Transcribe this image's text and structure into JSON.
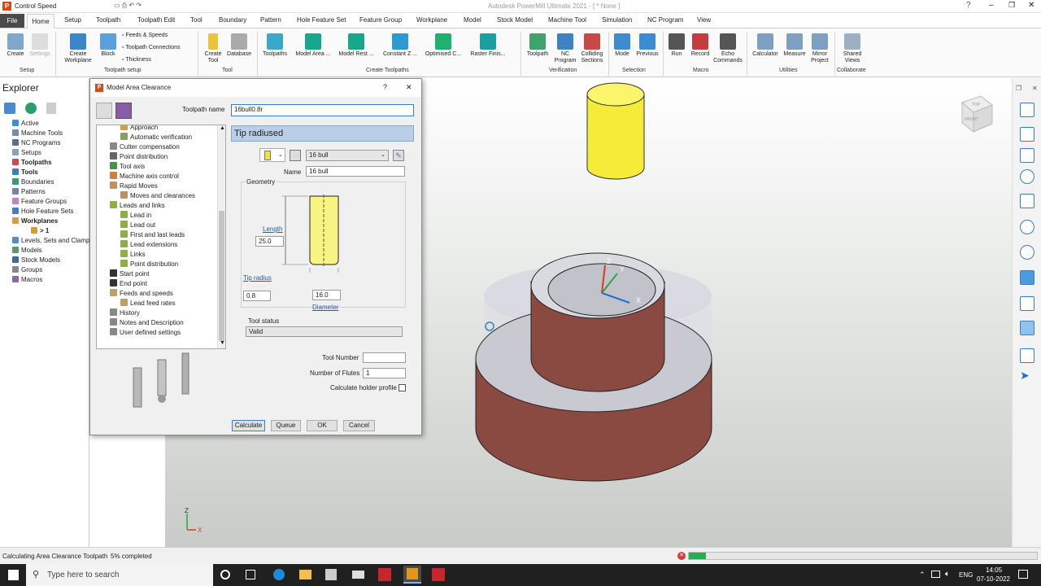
{
  "app": {
    "title": "Control Speed",
    "window_title": "Autodesk PowerMill Ultimate 2021 - [ * None ]"
  },
  "menu": {
    "tabs": [
      "File",
      "Home",
      "Setup",
      "Toolpath",
      "Toolpath Edit",
      "Tool",
      "Boundary",
      "Pattern",
      "Hole Feature Set",
      "Feature Group",
      "Workplane",
      "Model",
      "Stock Model",
      "Machine Tool",
      "Simulation",
      "NC Program",
      "View"
    ],
    "active": "Home"
  },
  "ribbon": {
    "setup": {
      "create": "Create",
      "settings": "Settings",
      "group": "Setup"
    },
    "toolpath_setup": {
      "create_workplane": "Create Workplane",
      "block": "Block",
      "feeds_speeds": "Feeds & Speeds",
      "toolpath_connections": "Toolpath Connections",
      "thickness": "Thickness",
      "group": "Toolpath setup"
    },
    "tool": {
      "create_tool": "Create Tool",
      "database": "Database",
      "group": "Tool"
    },
    "create_toolpaths": {
      "toolpaths": "Toolpaths",
      "model_area": "Model Area ...",
      "model_rest": "Model Rest ...",
      "constant_z": "Constant Z ...",
      "optimised": "Optimised C...",
      "raster": "Raster Finis...",
      "group": "Create Toolpaths"
    },
    "verification": {
      "toolpath": "Toolpath",
      "nc_program": "NC Program",
      "colliding": "Colliding Sections",
      "group": "Verification"
    },
    "selection": {
      "mode": "Mode",
      "previous": "Previous",
      "group": "Selection"
    },
    "macro": {
      "run": "Run",
      "record": "Record",
      "echo": "Echo Commands",
      "group": "Macro"
    },
    "utilities": {
      "calculator": "Calculator",
      "measure": "Measure",
      "mirror": "Mirror Project",
      "group": "Utilities"
    },
    "collaborate": {
      "shared": "Shared Views",
      "group": "Collaborate"
    }
  },
  "explorer": {
    "title": "Explorer",
    "items": [
      "Active",
      "Machine Tools",
      "NC Programs",
      "Setups",
      "Toolpaths",
      "Tools",
      "Boundaries",
      "Patterns",
      "Feature Groups",
      "Hole Feature Sets",
      "Workplanes",
      "> 1",
      "Levels, Sets and Clamps",
      "Models",
      "Stock Models",
      "Groups",
      "Macros"
    ]
  },
  "dialog": {
    "title": "Model Area Clearance",
    "toolpath_name_label": "Toolpath name",
    "toolpath_name": "16bull0.8r",
    "tree": [
      "Approach",
      "Automatic verification",
      "Cutter compensation",
      "Point distribution",
      "Tool axis",
      "Machine axis control",
      "Rapid Moves",
      "Moves and clearances",
      "Leads and links",
      "Lead in",
      "Lead out",
      "First and last leads",
      "Lead extensions",
      "Links",
      "Point distribution",
      "Start point",
      "End point",
      "Feeds and speeds",
      "Lead feed rates",
      "History",
      "Notes and Description",
      "User defined settings"
    ],
    "panel_title": "Tip radiused",
    "tool_select": "16 bull",
    "name_label": "Name",
    "name": "16 bull",
    "geometry_label": "Geometry",
    "length_label": "Length",
    "length": "25.0",
    "tip_radius_label": "Tip radius",
    "tip_radius": "0.8",
    "diameter": "16.0",
    "diameter_label": "Diameter",
    "tool_status_label": "Tool status",
    "tool_status": "Valid",
    "tool_number_label": "Tool Number",
    "tool_number": "",
    "flutes_label": "Number of Flutes",
    "flutes": "1",
    "holder_label": "Calculate holder profile",
    "buttons": {
      "calculate": "Calculate",
      "queue": "Queue",
      "ok": "OK",
      "cancel": "Cancel"
    },
    "help": "?",
    "close": "✕"
  },
  "status": {
    "text": "Calculating Area Clearance Toolpath",
    "progress_text": "5% completed",
    "progress": 0.05
  },
  "taskbar": {
    "search_placeholder": "Type here to search",
    "lang": "ENG",
    "time": "14:05",
    "date": "07-10-2022"
  },
  "viewport": {
    "axes": {
      "x": "X",
      "y": "Y",
      "z": "Z"
    },
    "cube_top": "TOP",
    "cube_front": "FRONT"
  },
  "colors": {
    "accent": "#1a6fb7",
    "dialog_header": "#b9cfe6",
    "part_brown": "#8a4a42",
    "tool_yellow": "#f5ec3a"
  }
}
